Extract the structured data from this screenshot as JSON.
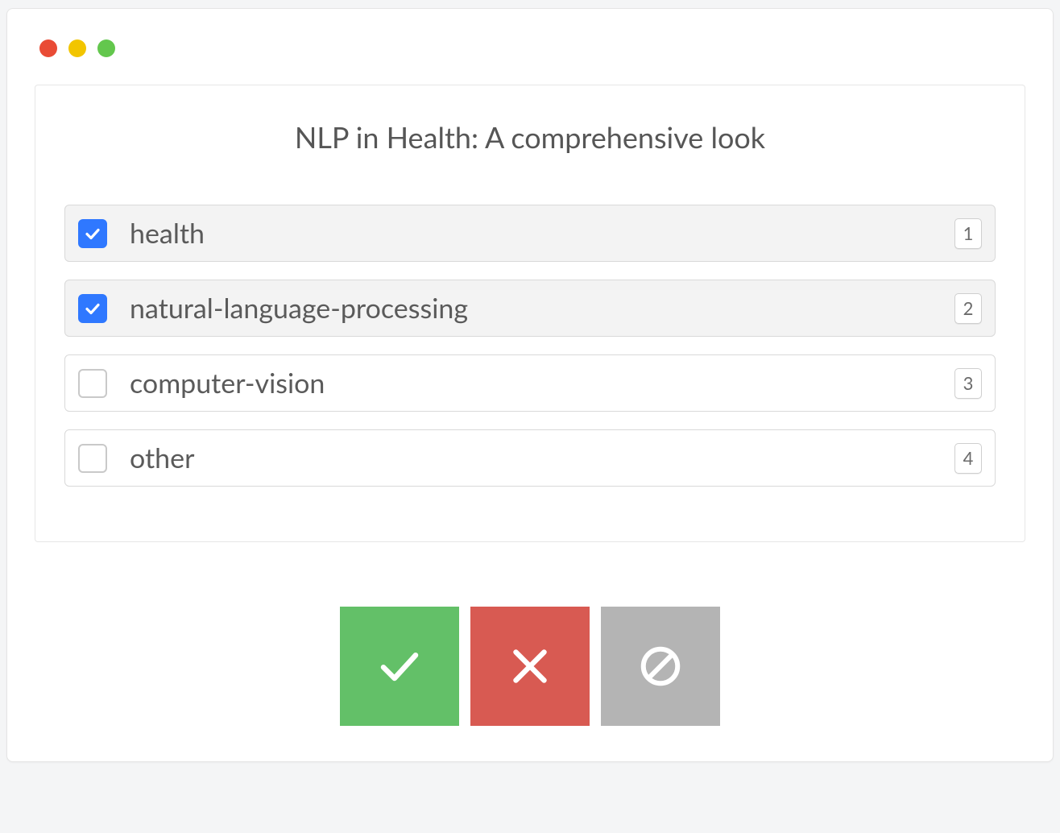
{
  "window": {
    "traffic_lights": {
      "red": "#e94b35",
      "yellow": "#f2c500",
      "green": "#63c74d"
    }
  },
  "card": {
    "title": "NLP in Health: A comprehensive look",
    "options": [
      {
        "label": "health",
        "checked": true,
        "key": "1"
      },
      {
        "label": "natural-language-processing",
        "checked": true,
        "key": "2"
      },
      {
        "label": "computer-vision",
        "checked": false,
        "key": "3"
      },
      {
        "label": "other",
        "checked": false,
        "key": "4"
      }
    ]
  },
  "actions": {
    "accept_icon": "check-icon",
    "reject_icon": "x-icon",
    "skip_icon": "ban-icon",
    "accept_color": "#63c068",
    "reject_color": "#d85a52",
    "skip_color": "#b4b4b4"
  }
}
